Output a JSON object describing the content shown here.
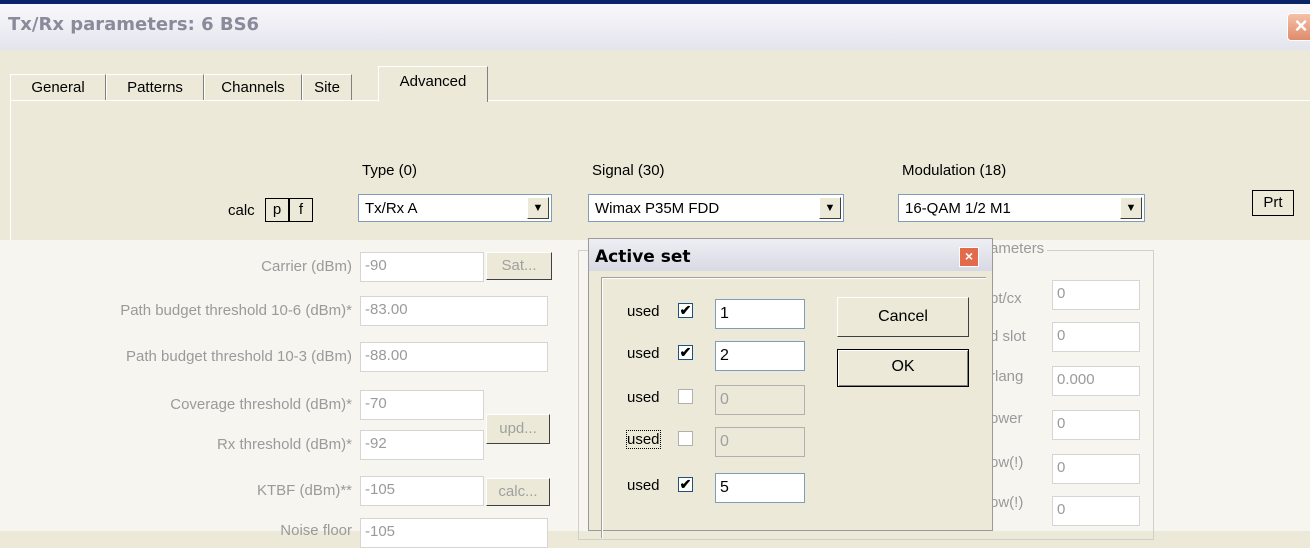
{
  "window": {
    "title": "Tx/Rx parameters: 6 BS6"
  },
  "tabs": [
    {
      "label": "General"
    },
    {
      "label": "Patterns"
    },
    {
      "label": "Channels"
    },
    {
      "label": "Site"
    },
    {
      "label": "Advanced"
    }
  ],
  "header": {
    "calc_label": "calc",
    "calc_p": "p",
    "calc_f": "f",
    "type_label": "Type (0)",
    "type_value": "Tx/Rx A",
    "signal_label": "Signal (30)",
    "signal_value": "Wimax P35M FDD",
    "modulation_label": "Modulation (18)",
    "modulation_value": "16-QAM 1/2 M1",
    "prt_label": "Prt"
  },
  "fields": [
    {
      "label": "Carrier (dBm)",
      "value": "-90"
    },
    {
      "label": "Path budget threshold 10-6 (dBm)*",
      "value": "-83.00"
    },
    {
      "label": "Path budget threshold 10-3 (dBm)",
      "value": "-88.00"
    },
    {
      "label": "Coverage threshold (dBm)*",
      "value": "-70"
    },
    {
      "label": "Rx threshold (dBm)*",
      "value": "-92"
    },
    {
      "label": "KTBF (dBm)**",
      "value": "-105"
    },
    {
      "label": "Noise floor",
      "value": "-105"
    }
  ],
  "buttons": {
    "sat": "Sat...",
    "upd": "upd...",
    "calc": "calc..."
  },
  "right_panel": {
    "group_title": "ameters",
    "rows": [
      {
        "label": "pt/cx",
        "value": "0"
      },
      {
        "label": "d slot",
        "value": "0"
      },
      {
        "label": "rlang",
        "value": "0.000"
      },
      {
        "label": "ower",
        "value": "0"
      },
      {
        "label": "ow(!)",
        "value": "0"
      },
      {
        "label": "ow(!)",
        "value": "0"
      }
    ]
  },
  "dialog": {
    "title": "Active set",
    "cancel": "Cancel",
    "ok": "OK",
    "rows": [
      {
        "label": "used",
        "checked": true,
        "value": "1"
      },
      {
        "label": "used",
        "checked": true,
        "value": "2"
      },
      {
        "label": "used",
        "checked": false,
        "value": "0"
      },
      {
        "label": "used",
        "checked": false,
        "value": "0"
      },
      {
        "label": "used",
        "checked": true,
        "value": "5"
      }
    ],
    "check_glyph": "✔"
  },
  "icons": {
    "close": "×",
    "dropdown": "▼"
  }
}
